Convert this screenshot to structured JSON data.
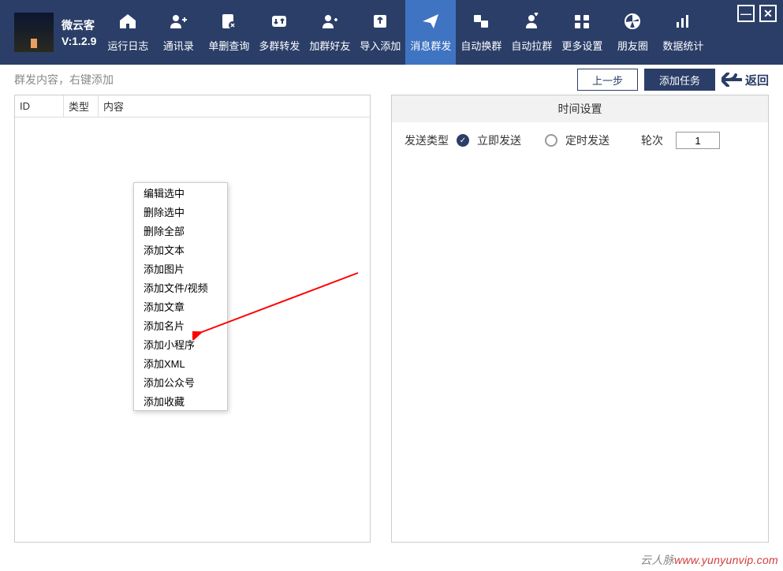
{
  "app": {
    "name": "微云客",
    "version": "V:1.2.9"
  },
  "nav": {
    "items": [
      {
        "label": "运行日志"
      },
      {
        "label": "通讯录"
      },
      {
        "label": "单删查询"
      },
      {
        "label": "多群转发"
      },
      {
        "label": "加群好友"
      },
      {
        "label": "导入添加"
      },
      {
        "label": "消息群发",
        "active": true
      },
      {
        "label": "自动换群"
      },
      {
        "label": "自动拉群"
      },
      {
        "label": "更多设置"
      },
      {
        "label": "朋友圈"
      },
      {
        "label": "数据统计"
      }
    ]
  },
  "toolbar": {
    "hint": "群发内容，右键添加",
    "prev": "上一步",
    "add_task": "添加任务",
    "back": "返回"
  },
  "table": {
    "col_id": "ID",
    "col_type": "类型",
    "col_content": "内容"
  },
  "context_menu": {
    "items": [
      "编辑选中",
      "删除选中",
      "删除全部",
      "添加文本",
      "添加图片",
      "添加文件/视频",
      "添加文章",
      "添加名片",
      "添加小程序",
      "添加XML",
      "添加公众号",
      "添加收藏"
    ]
  },
  "right": {
    "section_title": "时间设置",
    "send_type_label": "发送类型",
    "opt_now": "立即发送",
    "opt_sched": "定时发送",
    "rounds_label": "轮次",
    "rounds_value": "1"
  },
  "watermark": {
    "prefix": "云人脉",
    "domain": "www.yunyunvip.com"
  }
}
